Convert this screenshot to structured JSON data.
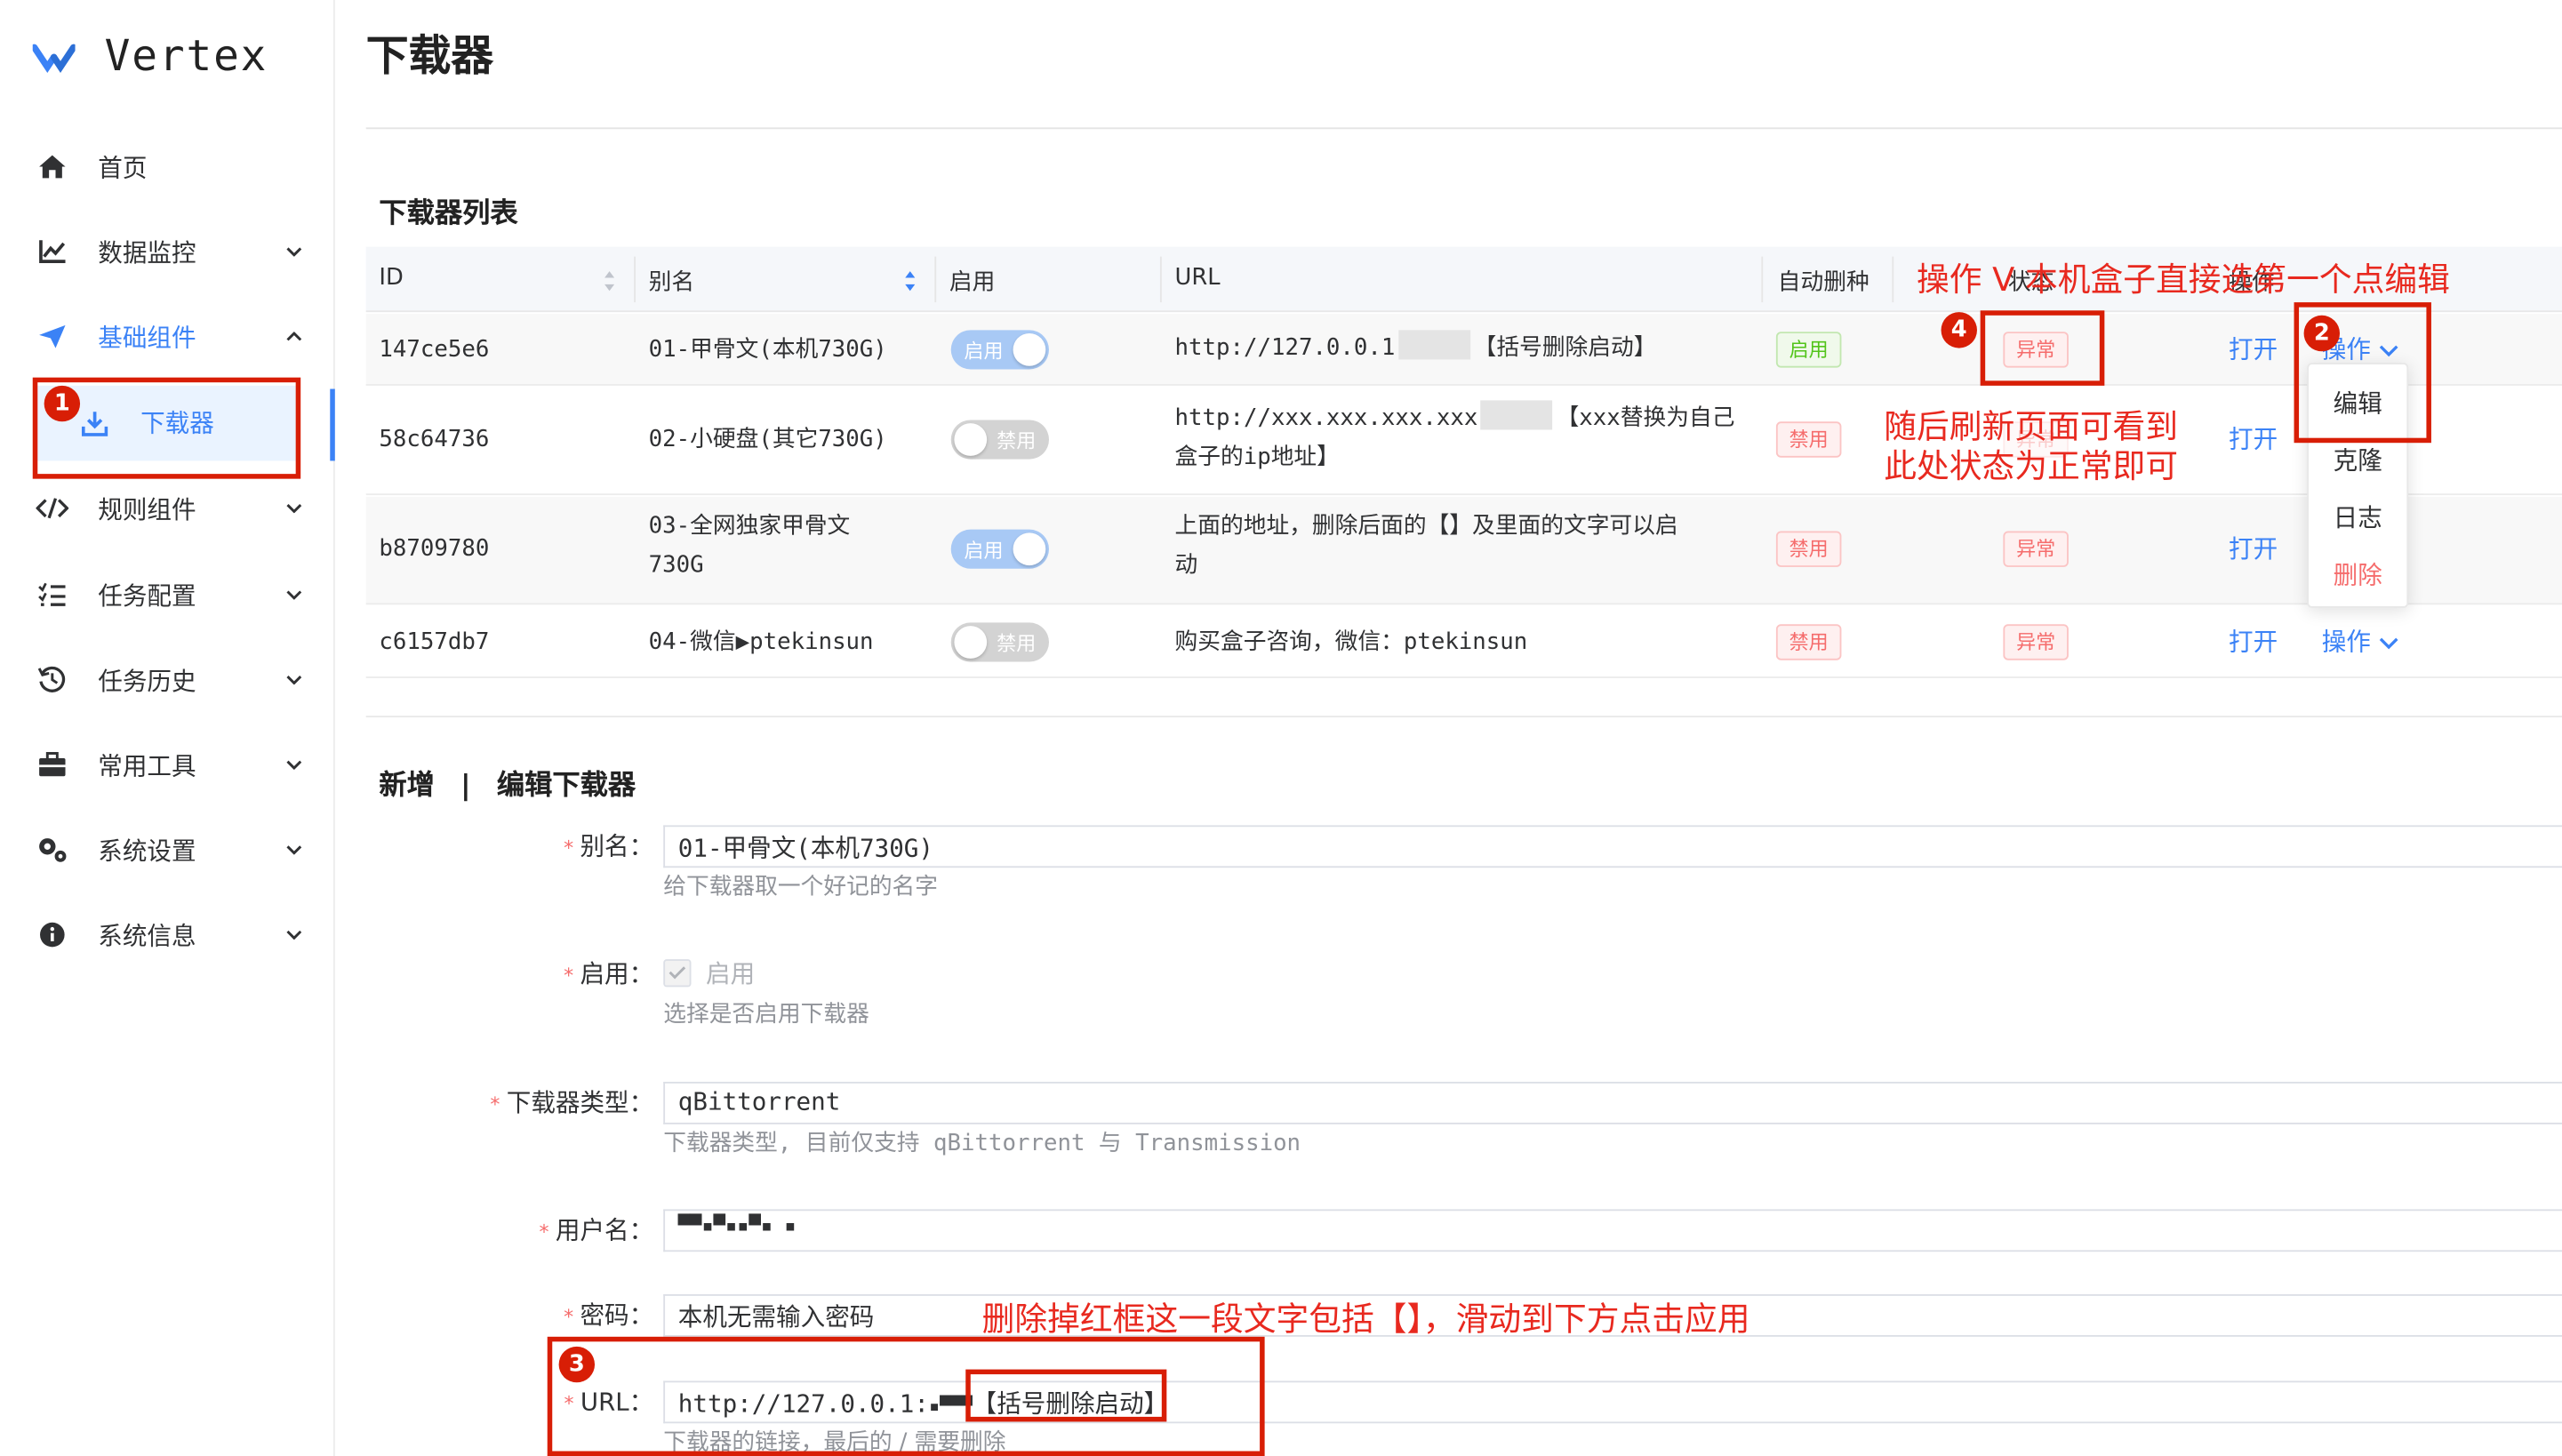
{
  "app": {
    "name": "Vertex"
  },
  "sidebar": {
    "items": [
      {
        "label": "首页",
        "icon": "home-icon"
      },
      {
        "label": "数据监控",
        "icon": "chart-line-icon"
      },
      {
        "label": "基础组件",
        "icon": "paper-plane-icon",
        "expanded": true
      },
      {
        "label": "下载器",
        "icon": "download-icon",
        "active": true
      },
      {
        "label": "规则组件",
        "icon": "code-icon"
      },
      {
        "label": "任务配置",
        "icon": "task-list-icon"
      },
      {
        "label": "任务历史",
        "icon": "history-icon"
      },
      {
        "label": "常用工具",
        "icon": "toolbox-icon"
      },
      {
        "label": "系统设置",
        "icon": "gears-icon"
      },
      {
        "label": "系统信息",
        "icon": "info-icon"
      }
    ]
  },
  "page": {
    "title": "下载器"
  },
  "list": {
    "title": "下载器列表",
    "columns": [
      "ID",
      "别名",
      "启用",
      "URL",
      "自动删种",
      "状态",
      "操作"
    ],
    "rows": [
      {
        "id": "147ce5e6",
        "alias": "01-甲骨文(本机730G)",
        "alias2": "",
        "enabled": "启用",
        "url": "http://127.0.0.1",
        "url_tail": "【括号删除启动】",
        "url2": "",
        "auto_delete": "启用",
        "status": "异常",
        "open": "打开",
        "action": "操作"
      },
      {
        "id": "58c64736",
        "alias": "02-小硬盘(其它730G)",
        "alias2": "",
        "enabled": "禁用",
        "url": "http://xxx.xxx.xxx.xxx",
        "url_tail": "【xxx替换为自己",
        "url2": "盒子的ip地址】",
        "auto_delete": "禁用",
        "status": "异常",
        "open": "打开",
        "action": "操作"
      },
      {
        "id": "b8709780",
        "alias": "03-全网独家甲骨文",
        "alias2": "730G",
        "enabled": "启用",
        "url": "上面的地址，删除后面的【】及里面的文字可以启",
        "url_tail": "",
        "url2": "动",
        "auto_delete": "禁用",
        "status": "异常",
        "open": "打开",
        "action": "操作"
      },
      {
        "id": "c6157db7",
        "alias": "04-微信▶ptekinsun",
        "alias2": "",
        "enabled": "禁用",
        "url": "购买盒子咨询，微信：ptekinsun",
        "url_tail": "",
        "url2": "",
        "auto_delete": "禁用",
        "status": "异常",
        "open": "打开",
        "action": "操作"
      }
    ]
  },
  "dropdown": {
    "items": [
      "编辑",
      "克隆",
      "日志",
      "删除"
    ]
  },
  "form": {
    "title_new": "新增",
    "separator": "|",
    "title_edit": "编辑下载器",
    "alias": {
      "label": "别名：",
      "value": "01-甲骨文(本机730G)",
      "hint": "给下载器取一个好记的名字"
    },
    "enable": {
      "label": "启用：",
      "checkbox_label": "启用",
      "hint": "选择是否启用下载器"
    },
    "type": {
      "label": "下载器类型：",
      "value": "qBittorrent",
      "hint": "下载器类型, 目前仅支持 qBittorrent 与 Transmission"
    },
    "username": {
      "label": "用户名：",
      "value": "▀▀▪▀▪▪▀▪ ▪"
    },
    "password": {
      "label": "密码：",
      "value": "本机无需输入密码"
    },
    "url": {
      "label": "URL：",
      "value": "http://127.0.0.1:",
      "masked": "▪▀▀▀",
      "tail": "【括号删除启动】",
      "hint": "下载器的链接，最后的 / 需要删除"
    }
  },
  "annotations": {
    "note1": "操作 V 本机盒子直接选第一个点编辑",
    "note2_line1": "随后刷新页面可看到",
    "note2_line2": "此处状态为正常即可",
    "note3": "删除掉红框这一段文字包括【】，滑动到下方点击应用",
    "badges": [
      "1",
      "2",
      "3",
      "4"
    ]
  },
  "colors": {
    "accent": "#3b82f6",
    "annotation": "#e8291f",
    "danger": "#f56c6c",
    "success": "#52c41a"
  }
}
